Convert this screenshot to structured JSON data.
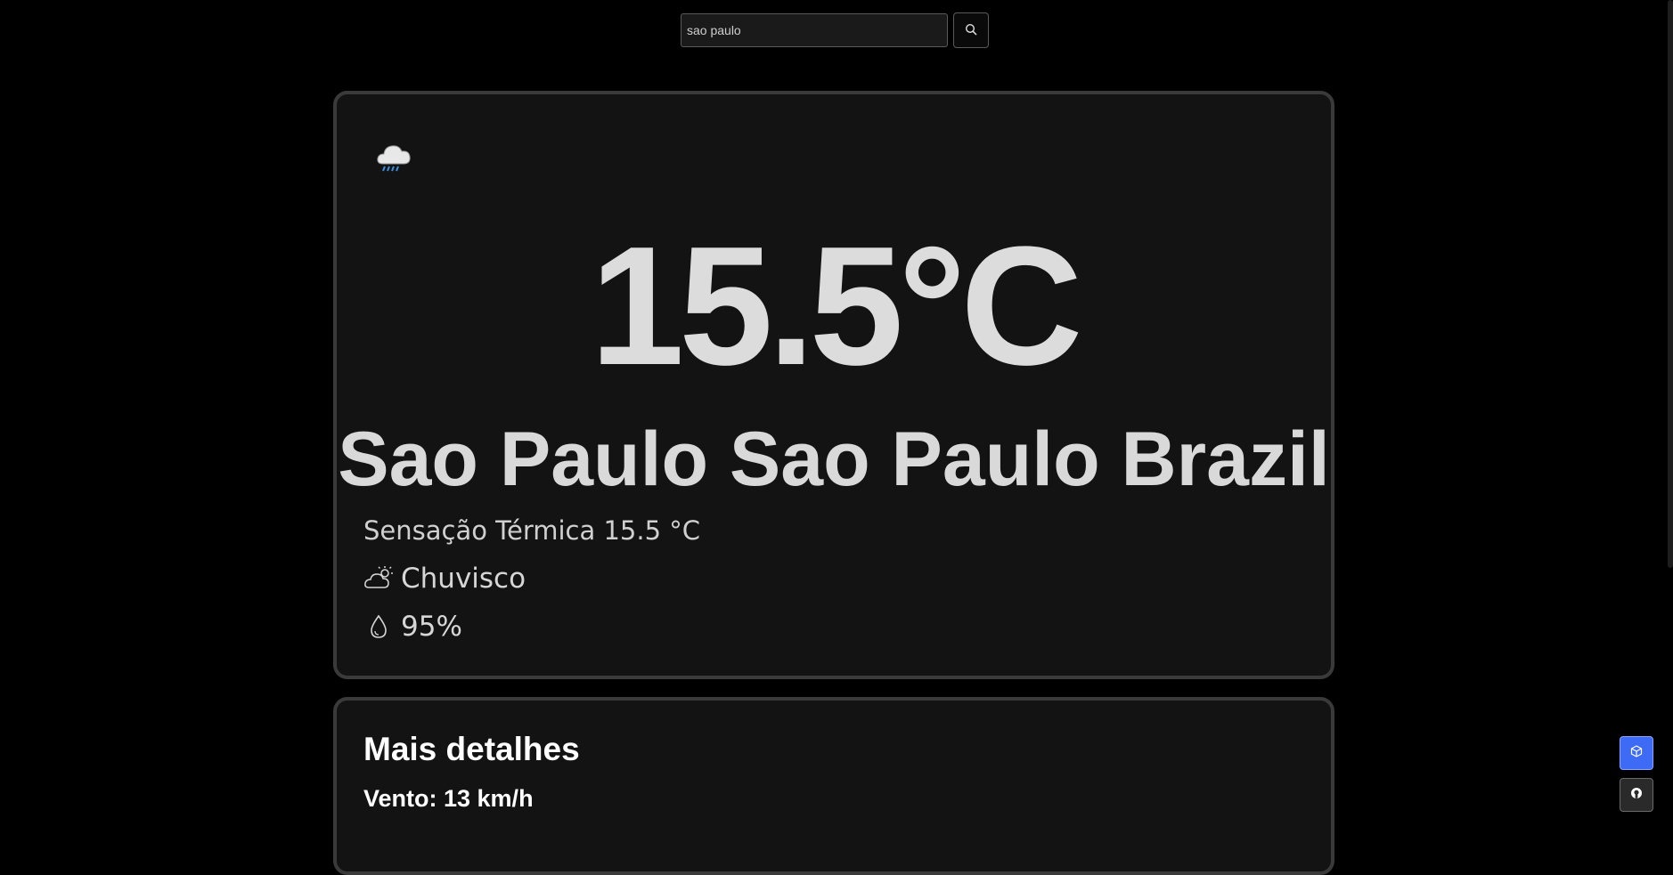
{
  "search": {
    "value": "sao paulo",
    "placeholder": "",
    "button_icon": "search-icon"
  },
  "current": {
    "weather_icon": "cloud-rain-icon",
    "temperature": "15.5°C",
    "location": "Sao Paulo Sao Paulo Brazil",
    "feels_like": "Sensação Térmica 15.5 °C",
    "condition_icon": "cloud-sun-icon",
    "condition": "Chuvisco",
    "humidity_icon": "droplet-icon",
    "humidity": "95%"
  },
  "details": {
    "title": "Mais detalhes",
    "wind": "Vento: 13 km/h"
  },
  "floating_buttons": [
    {
      "icon": "cube-icon",
      "color": "#3e6bf5"
    },
    {
      "icon": "github-icon",
      "color": "#2a2a2a"
    }
  ],
  "colors": {
    "background": "#000000",
    "card": "#131313",
    "card_border": "#3a3a3a",
    "accent": "#3e6bf5"
  }
}
